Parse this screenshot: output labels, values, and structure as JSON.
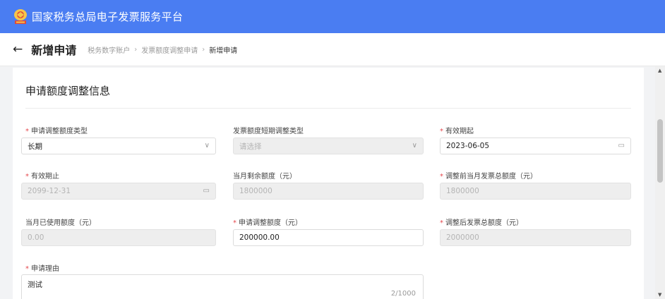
{
  "app": {
    "title": "国家税务总局电子发票服务平台",
    "brand_color": "#4a7df2"
  },
  "header": {
    "page_title": "新增申请",
    "breadcrumb": [
      "税务数字账户",
      "发票额度调整申请",
      "新增申请"
    ],
    "breadcrumb_sep": "›"
  },
  "section": {
    "title": "申请额度调整信息"
  },
  "fields": {
    "adjust_type": {
      "label": "申请调整额度类型",
      "required": "*",
      "value": "长期"
    },
    "short_type": {
      "label": "发票额度短期调整类型",
      "placeholder": "请选择"
    },
    "valid_from": {
      "label": "有效期起",
      "required": "*",
      "value": "2023-06-05"
    },
    "valid_to": {
      "label": "有效期止",
      "required": "*",
      "value": "2099-12-31"
    },
    "month_remaining": {
      "label": "当月剩余额度（元）",
      "value": "1800000"
    },
    "before_total": {
      "label": "调整前当月发票总额度（元）",
      "required": "*",
      "value": "1800000"
    },
    "month_used": {
      "label": "当月已使用额度（元）",
      "value": "0.00"
    },
    "adjust_amount": {
      "label": "申请调整额度（元）",
      "required": "*",
      "value": "200000.00"
    },
    "after_total": {
      "label": "调整后发票总额度（元）",
      "required": "*",
      "value": "2000000"
    },
    "reason": {
      "label": "申请理由",
      "required": "*",
      "value": "测试",
      "count": "2/1000"
    }
  },
  "icons": {
    "back": "←",
    "chevron": "∨",
    "calendar": "▭",
    "scroll_up": "▲",
    "scroll_down": "▼"
  }
}
